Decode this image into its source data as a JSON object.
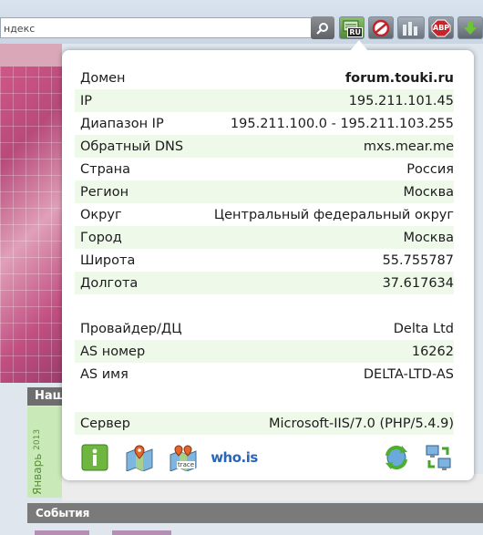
{
  "toolbar": {
    "search_text": "ндекс",
    "ru_label": "RU",
    "abp_label": "ABP"
  },
  "page": {
    "band_label": "Нащ",
    "calendar_label": "Январь",
    "calendar_year": "2013",
    "events_label": "События"
  },
  "popup": {
    "rows_block1": [
      {
        "label": "Домен",
        "value": "forum.touki.ru"
      },
      {
        "label": "IP",
        "value": "195.211.101.45"
      },
      {
        "label": "Диапазон IP",
        "value": "195.211.100.0 - 195.211.103.255"
      },
      {
        "label": "Обратный DNS",
        "value": "mxs.mear.me"
      },
      {
        "label": "Страна",
        "value": "Россия"
      },
      {
        "label": "Регион",
        "value": "Москва"
      },
      {
        "label": "Округ",
        "value": "Центральный федеральный округ"
      },
      {
        "label": "Город",
        "value": "Москва"
      },
      {
        "label": "Широта",
        "value": "55.755787"
      },
      {
        "label": "Долгота",
        "value": "37.617634"
      }
    ],
    "rows_block2": [
      {
        "label": "Провайдер/ДЦ",
        "value": "Delta Ltd"
      },
      {
        "label": "AS номер",
        "value": "16262"
      },
      {
        "label": "AS имя",
        "value": "DELTA-LTD-AS"
      }
    ],
    "server": {
      "label": "Сервер",
      "value": "Microsoft-IIS/7.0 (PHP/5.4.9)"
    },
    "actions": {
      "trace_label": "trace",
      "whois_label": "who.is"
    }
  }
}
